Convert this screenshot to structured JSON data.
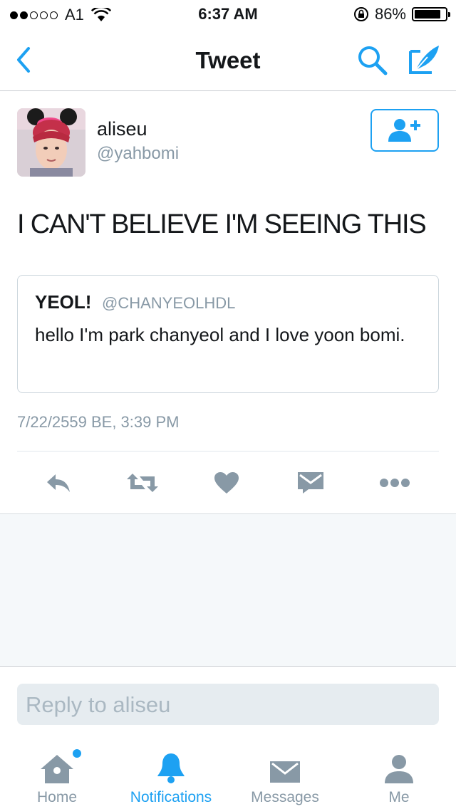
{
  "status_bar": {
    "carrier": "A1",
    "time": "6:37 AM",
    "battery_percent": "86%",
    "battery_level": 0.86,
    "signal_bars_filled": 2,
    "signal_bars_total": 5
  },
  "nav": {
    "title": "Tweet",
    "back_icon": "chevron-left-icon",
    "search_icon": "search-icon",
    "compose_icon": "compose-icon",
    "accent_color": "#1da1f2"
  },
  "tweet": {
    "display_name": "aliseu",
    "handle": "@yahbomi",
    "text": "I CAN'T BELIEVE I'M SEEING THIS",
    "timestamp": "7/22/2559 BE, 3:39 PM",
    "quoted": {
      "display_name": "YEOL!",
      "handle": "@CHANYEOLHDL",
      "text": "hello I'm park chanyeol and I love yoon bomi."
    }
  },
  "actions": [
    "reply-icon",
    "retweet-icon",
    "like-icon",
    "direct-message-icon",
    "more-icon"
  ],
  "reply": {
    "placeholder": "Reply to aliseu"
  },
  "tabs": [
    {
      "label": "Home",
      "icon": "home-icon"
    },
    {
      "label": "Notifications",
      "icon": "bell-icon"
    },
    {
      "label": "Messages",
      "icon": "envelope-icon"
    },
    {
      "label": "Me",
      "icon": "person-icon"
    }
  ]
}
